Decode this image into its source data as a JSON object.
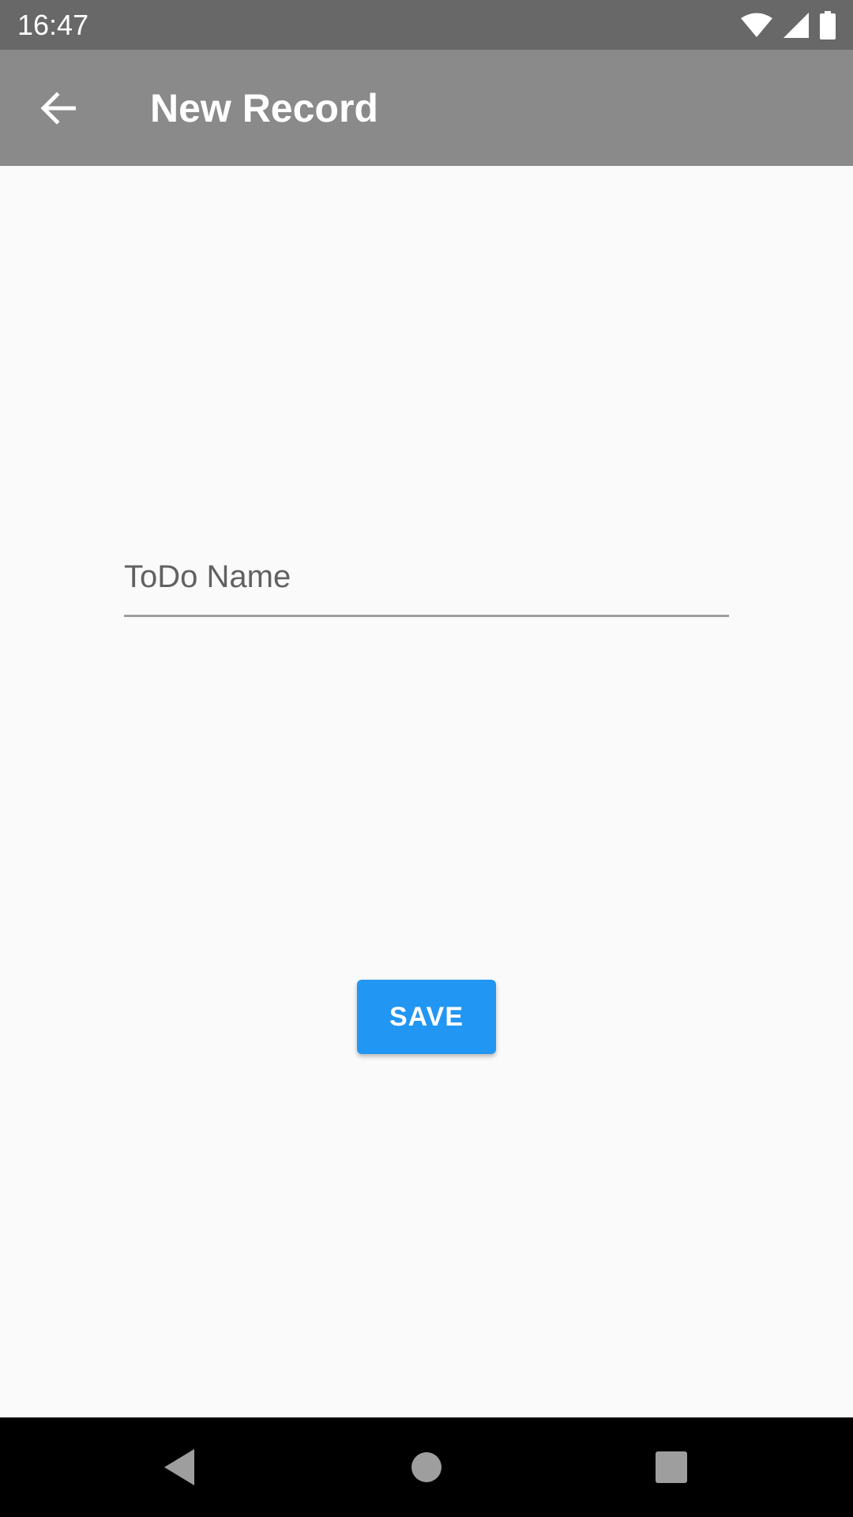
{
  "status_bar": {
    "time": "16:47",
    "icons": [
      "wifi-icon",
      "signal-icon",
      "battery-icon"
    ]
  },
  "app_bar": {
    "title": "New Record",
    "back_icon": "arrow-back-icon",
    "background_color": "#8a8a8a"
  },
  "form": {
    "todo_name": {
      "placeholder": "ToDo Name",
      "value": ""
    },
    "save_label": "SAVE",
    "save_color": "#2196f3"
  },
  "nav_bar": {
    "icons": [
      "back-triangle-icon",
      "home-circle-icon",
      "recents-square-icon"
    ]
  }
}
